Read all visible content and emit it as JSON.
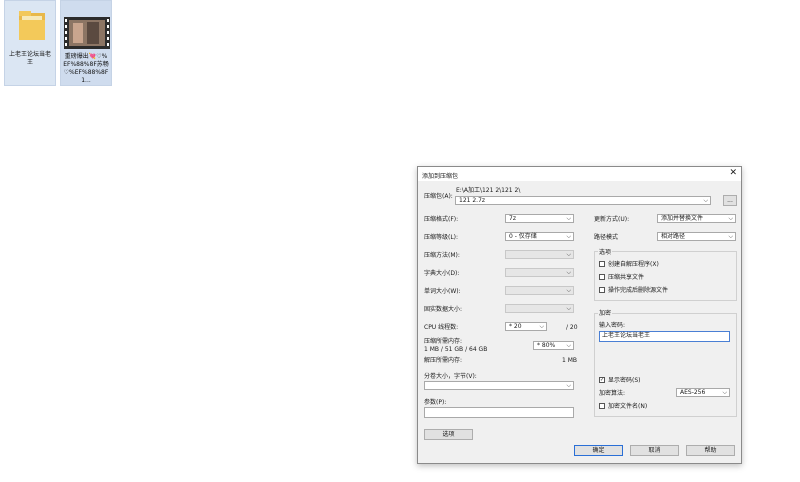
{
  "desktop": {
    "icons": [
      {
        "name": "folder-icon",
        "label": "上老王论坛当老王"
      },
      {
        "name": "video-thumbnail-icon",
        "label": "重磅爆出💘♡%EF%88%8F苏畅♡%EF%88%8F1..."
      }
    ]
  },
  "dialog": {
    "title": "添加到压缩包",
    "close_glyph": "✕",
    "archive": {
      "label": "压缩包(A):",
      "path": "E:\\A加工\\121 2\\121 2\\",
      "filename": "121 2.7z",
      "browse": "..."
    },
    "left": {
      "format": {
        "label": "压缩格式(F):",
        "value": "7z"
      },
      "level": {
        "label": "压缩等级(L):",
        "value": "0 - 仅存储"
      },
      "method": {
        "label": "压缩方法(M):",
        "value": ""
      },
      "dict": {
        "label": "字典大小(D):",
        "value": ""
      },
      "word": {
        "label": "单词大小(W):",
        "value": ""
      },
      "solid": {
        "label": "固实数据大小:",
        "value": ""
      },
      "threads": {
        "label": "CPU 线程数:",
        "value": "* 20",
        "max": "/ 20"
      },
      "mem_comp": {
        "label": "压缩所需内存:",
        "detail": "1 MB / 51 GB / 64 GB",
        "value": "* 80%"
      },
      "mem_decomp": {
        "label": "解压所需内存:",
        "value": "1 MB"
      },
      "split": {
        "label": "分卷大小，字节(V):",
        "value": ""
      },
      "params": {
        "label": "参数(P):",
        "value": ""
      },
      "options_btn": "选项"
    },
    "right": {
      "update": {
        "label": "更新方式(U):",
        "value": "添加并替换文件"
      },
      "pathmode": {
        "label": "路径模式",
        "value": "相对路径"
      },
      "options_group": {
        "title": "选项",
        "sfx": "创建自解压程序(X)",
        "shared": "压缩共享文件",
        "delete": "操作完成后删除源文件"
      },
      "encryption": {
        "title": "加密",
        "pwd_label": "输入密码:",
        "pwd_value": "上老王论坛当老王",
        "show_pwd": "显示密码(S)",
        "show_pwd_checked": "✓",
        "algo_label": "加密算法:",
        "algo_value": "AES-256",
        "encrypt_names": "加密文件名(N)"
      }
    },
    "buttons": {
      "ok": "确定",
      "cancel": "取消",
      "help": "帮助"
    }
  }
}
